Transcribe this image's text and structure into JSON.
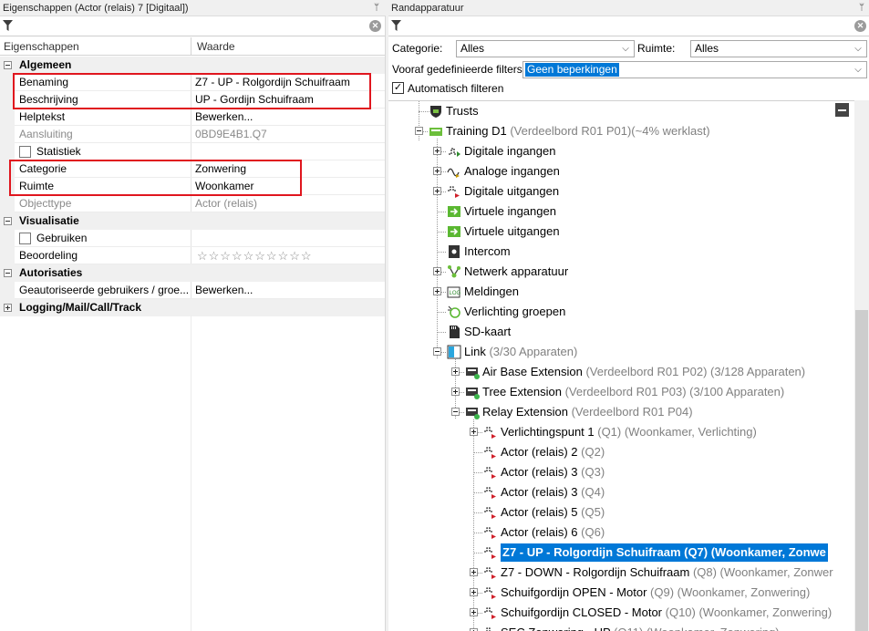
{
  "left_panel": {
    "title": "Eigenschappen (Actor (relais) 7 [Digitaal])",
    "pin": "ᛘ",
    "columns": {
      "name": "Eigenschappen",
      "value": "Waarde"
    },
    "categories": {
      "algemeen": "Algemeen",
      "visualisatie": "Visualisatie",
      "autorisaties": "Autorisaties",
      "logging": "Logging/Mail/Call/Track"
    },
    "rows": {
      "benaming": {
        "name": "Benaming",
        "value": "Z7 - UP - Rolgordijn Schuifraam"
      },
      "beschrijving": {
        "name": "Beschrijving",
        "value": "UP - Gordijn Schuifraam"
      },
      "helptekst": {
        "name": "Helptekst",
        "value": "Bewerken..."
      },
      "aansluiting": {
        "name": "Aansluiting",
        "value": "0BD9E4B1.Q7"
      },
      "statistiek": {
        "name": "Statistiek"
      },
      "categorie": {
        "name": "Categorie",
        "value": "Zonwering"
      },
      "ruimte": {
        "name": "Ruimte",
        "value": "Woonkamer"
      },
      "objecttype": {
        "name": "Objecttype",
        "value": "Actor (relais)"
      },
      "gebruiken": {
        "name": "Gebruiken"
      },
      "beoordeling": {
        "name": "Beoordeling",
        "value": "☆☆☆☆☆☆☆☆☆☆"
      },
      "gebruikers": {
        "name": "Geautoriseerde gebruikers / groe...",
        "value": "Bewerken..."
      }
    }
  },
  "right_panel": {
    "title": "Randapparatuur",
    "pin": "ᛘ",
    "filters": {
      "categorie_label": "Categorie:",
      "categorie_value": "Alles",
      "ruimte_label": "Ruimte:",
      "ruimte_value": "Alles",
      "predefined_label": "Vooraf gedefinieerde filters",
      "predefined_value": "Geen beperkingen",
      "auto_filter_label": "Automatisch filteren",
      "auto_filter_checked": true
    },
    "tree": [
      {
        "label": "Trusts",
        "detail": ""
      },
      {
        "label": "Training D1",
        "detail": " (Verdeelbord R01 P01)(~4% werklast)"
      },
      {
        "label": "Digitale ingangen",
        "detail": ""
      },
      {
        "label": "Analoge ingangen",
        "detail": ""
      },
      {
        "label": "Digitale uitgangen",
        "detail": ""
      },
      {
        "label": "Virtuele ingangen",
        "detail": ""
      },
      {
        "label": "Virtuele uitgangen",
        "detail": ""
      },
      {
        "label": "Intercom",
        "detail": ""
      },
      {
        "label": "Netwerk apparatuur",
        "detail": ""
      },
      {
        "label": "Meldingen",
        "detail": ""
      },
      {
        "label": "Verlichting groepen",
        "detail": ""
      },
      {
        "label": "SD-kaart",
        "detail": ""
      },
      {
        "label": "Link",
        "detail": " (3/30 Apparaten)"
      },
      {
        "label": "Air Base Extension",
        "detail": " (Verdeelbord R01 P02) (3/128 Apparaten)"
      },
      {
        "label": "Tree Extension",
        "detail": " (Verdeelbord R01 P03) (3/100 Apparaten)"
      },
      {
        "label": "Relay Extension",
        "detail": " (Verdeelbord R01 P04)"
      },
      {
        "label": "Verlichtingspunt 1",
        "detail": " (Q1) (Woonkamer, Verlichting)"
      },
      {
        "label": "Actor (relais) 2",
        "detail": " (Q2)"
      },
      {
        "label": "Actor (relais) 3",
        "detail": " (Q3)"
      },
      {
        "label": "Actor (relais) 3",
        "detail": " (Q4)"
      },
      {
        "label": "Actor (relais) 5",
        "detail": " (Q5)"
      },
      {
        "label": "Actor (relais) 6",
        "detail": " (Q6)"
      },
      {
        "label": "Z7 - UP - Rolgordijn Schuifraam (Q7) (Woonkamer, Zonwe",
        "detail": ""
      },
      {
        "label": "Z7 - DOWN - Rolgordijn Schuifraam",
        "detail": " (Q8) (Woonkamer, Zonwer"
      },
      {
        "label": "Schuifgordijn OPEN - Motor",
        "detail": " (Q9) (Woonkamer, Zonwering)"
      },
      {
        "label": "Schuifgordijn CLOSED - Motor",
        "detail": " (Q10) (Woonkamer, Zonwering)"
      },
      {
        "label": "SEC Zonwering - UP",
        "detail": " (Q11) (Woonkamer, Zonwering)"
      }
    ]
  },
  "colors": {
    "selection": "#0078d7",
    "highlight_box": "#e0161e",
    "device_ok": "#3cb44b"
  }
}
